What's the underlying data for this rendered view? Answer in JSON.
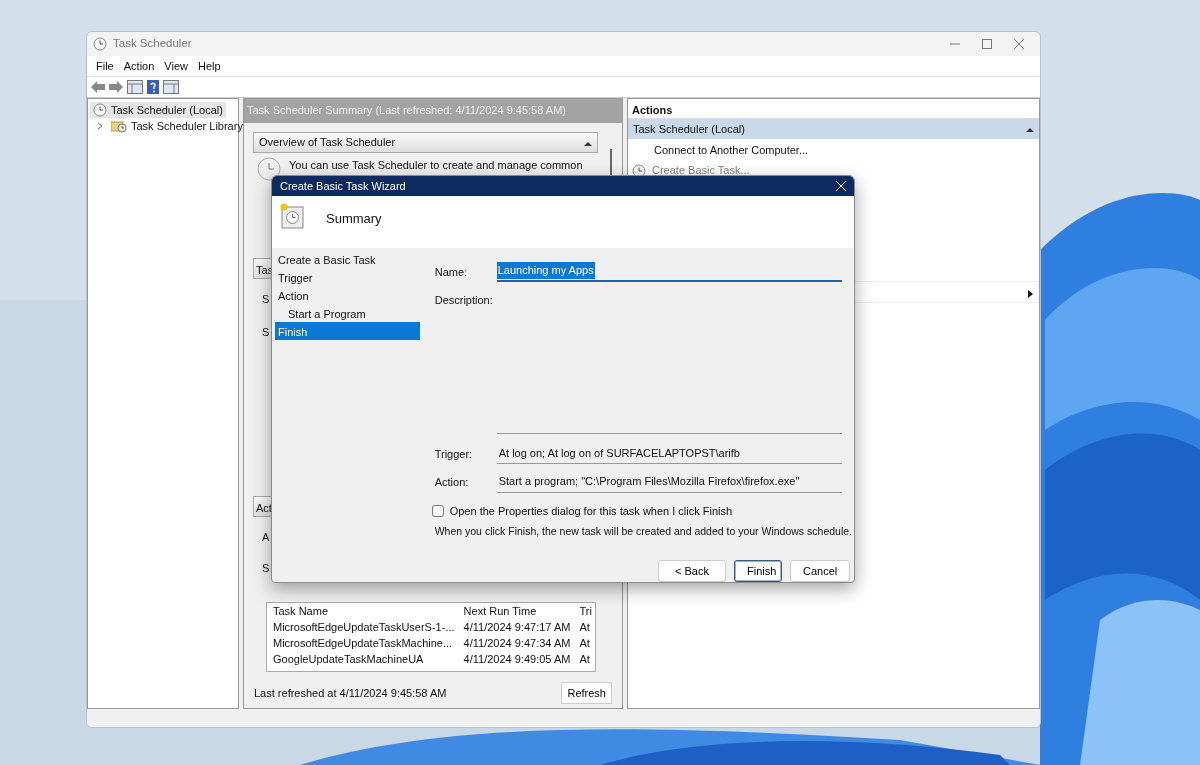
{
  "window": {
    "title": "Task Scheduler"
  },
  "menu": [
    "File",
    "Action",
    "View",
    "Help"
  ],
  "tree": [
    {
      "label": "Task Scheduler (Local)",
      "selected": true,
      "children": [
        {
          "label": "Task Scheduler Library",
          "selected": false,
          "expanded": false
        }
      ]
    }
  ],
  "summary": {
    "header": "Task Scheduler Summary (Last refreshed: 4/11/2024 9:45:58 AM)",
    "overview": {
      "title": "Overview of Task Scheduler",
      "expanded": true,
      "text": "You can use Task Scheduler to create and manage common"
    },
    "sections": [
      {
        "title": "Tas",
        "rows": [
          "S",
          "S"
        ]
      },
      {
        "title": "Act",
        "rows": [
          "A",
          "S"
        ]
      }
    ],
    "table": {
      "columns": [
        "Task Name",
        "Next Run Time",
        "Tri"
      ],
      "rows": [
        [
          "MicrosoftEdgeUpdateTaskUserS-1-...",
          "4/11/2024 9:47:17 AM",
          "At"
        ],
        [
          "MicrosoftEdgeUpdateTaskMachine...",
          "4/11/2024 9:47:34 AM",
          "At"
        ],
        [
          "GoogleUpdateTaskMachineUA",
          "4/11/2024 9:49:05 AM",
          "At"
        ]
      ]
    },
    "footer": "Last refreshed at 4/11/2024 9:45:58 AM",
    "refresh": "Refresh"
  },
  "actions": {
    "title": "Actions",
    "group": "Task Scheduler (Local)",
    "expanded": true,
    "items": [
      {
        "label": "Connect to Another Computer...",
        "kind": "plain"
      },
      {
        "label": "Create Basic Task...",
        "kind": "icon"
      },
      {
        "kind": "submenu"
      }
    ]
  },
  "dialog": {
    "title": "Create Basic Task Wizard",
    "heading": "Summary",
    "steps": [
      {
        "label": "Create a Basic Task",
        "selected": false
      },
      {
        "label": "Trigger",
        "selected": false
      },
      {
        "label": "Action",
        "selected": false,
        "children": [
          {
            "label": "Start a Program",
            "selected": false
          }
        ]
      },
      {
        "label": "Finish",
        "selected": true
      }
    ],
    "name": {
      "label": "Name:",
      "value": "Launching my Apps"
    },
    "description": {
      "label": "Description:"
    },
    "trigger": {
      "label": "Trigger:",
      "value": "At log on; At log on of SURFACELAPTOPST\\arifb"
    },
    "action": {
      "label": "Action:",
      "value": "Start a program; \"C:\\Program Files\\Mozilla Firefox\\firefox.exe\""
    },
    "open_properties": {
      "label": "Open the Properties dialog for this task when I click Finish",
      "checked": false
    },
    "note": "When you click Finish, the new task will be created and added to your Windows schedule.",
    "buttons": [
      {
        "label": "< Back",
        "kind": "normal"
      },
      {
        "label": "Finish",
        "kind": "default"
      },
      {
        "label": "Cancel",
        "kind": "normal"
      }
    ]
  }
}
